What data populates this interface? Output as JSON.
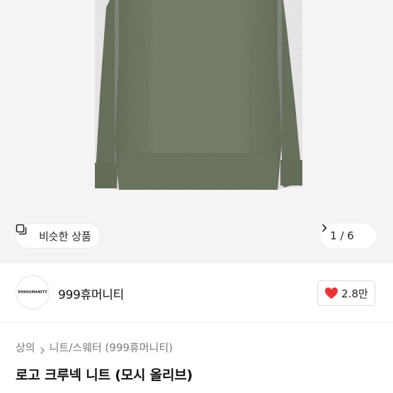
{
  "product_image": {
    "alt": "",
    "similar_button_label": "비슷한 상품",
    "counter": "1 / 6"
  },
  "seller": {
    "avatar_text": "999HUMANITY",
    "name": "999휴머니티",
    "likes": "2.8만"
  },
  "breadcrumb": {
    "level1": "상의",
    "level2": "니트/스웨터 (999휴머니티)"
  },
  "product": {
    "title": "로고 크루넥 니트 (모시 올리브)"
  },
  "colors": {
    "sweater": "#76806a",
    "heart": "#e8353b"
  }
}
